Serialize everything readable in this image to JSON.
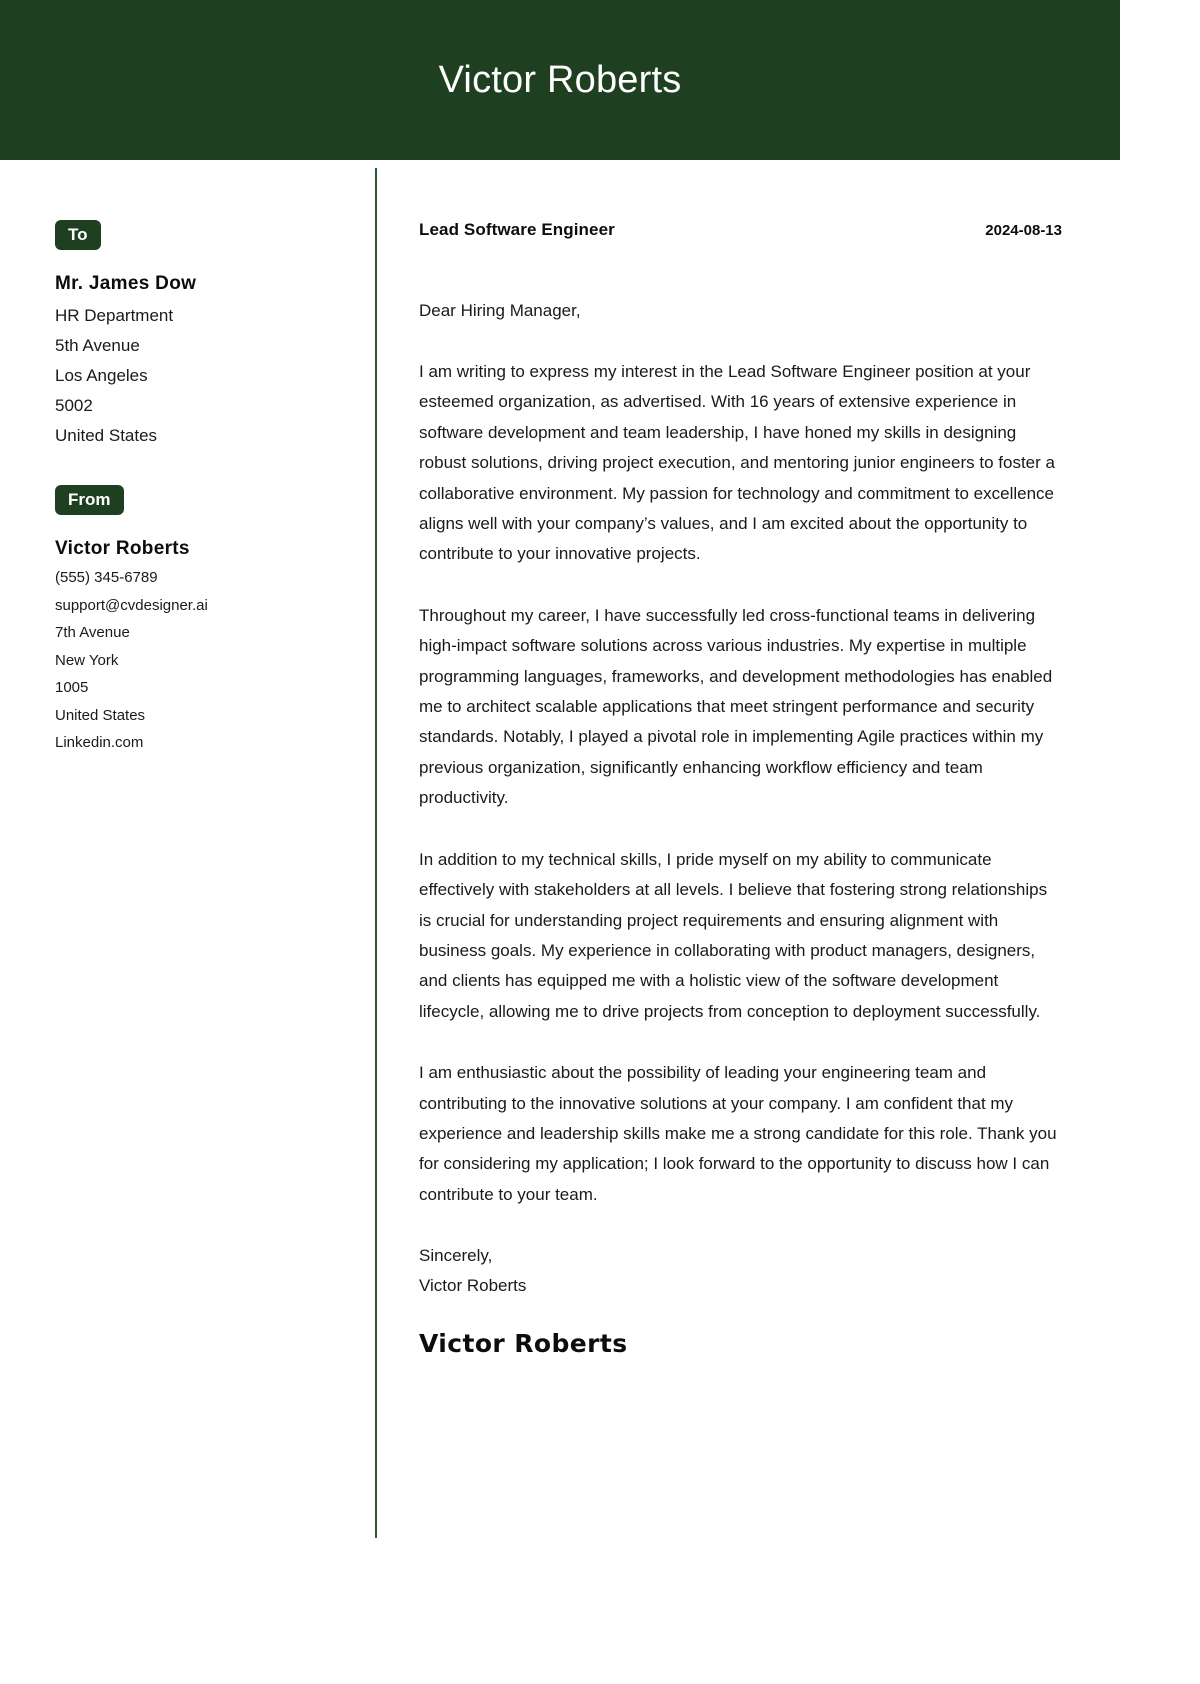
{
  "header": {
    "name": "Victor Roberts",
    "background_color": "#1F3F21"
  },
  "sidebar": {
    "to": {
      "chip_label": "To",
      "name": "Mr. James Dow",
      "lines": [
        "HR Department",
        "5th Avenue",
        "Los Angeles",
        "5002",
        "United States"
      ]
    },
    "from": {
      "chip_label": "From",
      "name": "Victor Roberts",
      "lines": [
        "(555) 345-6789",
        "support@cvdesigner.ai",
        "7th Avenue",
        "New York",
        "1005",
        "United States",
        "Linkedin.com"
      ]
    }
  },
  "letter": {
    "job_title": "Lead Software Engineer",
    "date": "2024-08-13",
    "salutation": "Dear Hiring Manager,",
    "paragraphs": [
      "I am writing to express my interest in the Lead Software Engineer position at your esteemed organization, as advertised. With 16 years of extensive experience in software development and team leadership, I have honed my skills in designing robust solutions, driving project execution, and mentoring junior engineers to foster a collaborative environment. My passion for technology and commitment to excellence aligns well with your company’s values, and I am excited about the opportunity to contribute to your innovative projects.",
      "Throughout my career, I have successfully led cross-functional teams in delivering high-impact software solutions across various industries. My expertise in multiple programming languages, frameworks, and development methodologies has enabled me to architect scalable applications that meet stringent performance and security standards. Notably, I played a pivotal role in implementing Agile practices within my previous organization, significantly enhancing workflow efficiency and team productivity.",
      "In addition to my technical skills, I pride myself on my ability to communicate effectively with stakeholders at all levels. I believe that fostering strong relationships is crucial for understanding project requirements and ensuring alignment with business goals. My experience in collaborating with product managers, designers, and clients has equipped me with a holistic view of the software development lifecycle, allowing me to drive projects from conception to deployment successfully.",
      "I am enthusiastic about the possibility of leading your engineering team and contributing to the innovative solutions at your company. I am confident that my experience and leadership skills make me a strong candidate for this role. Thank you for considering my application; I look forward to the opportunity to discuss how I can contribute to your team."
    ],
    "closing": "Sincerely,",
    "closing_name": "Victor Roberts",
    "signature": "Victor Roberts"
  }
}
